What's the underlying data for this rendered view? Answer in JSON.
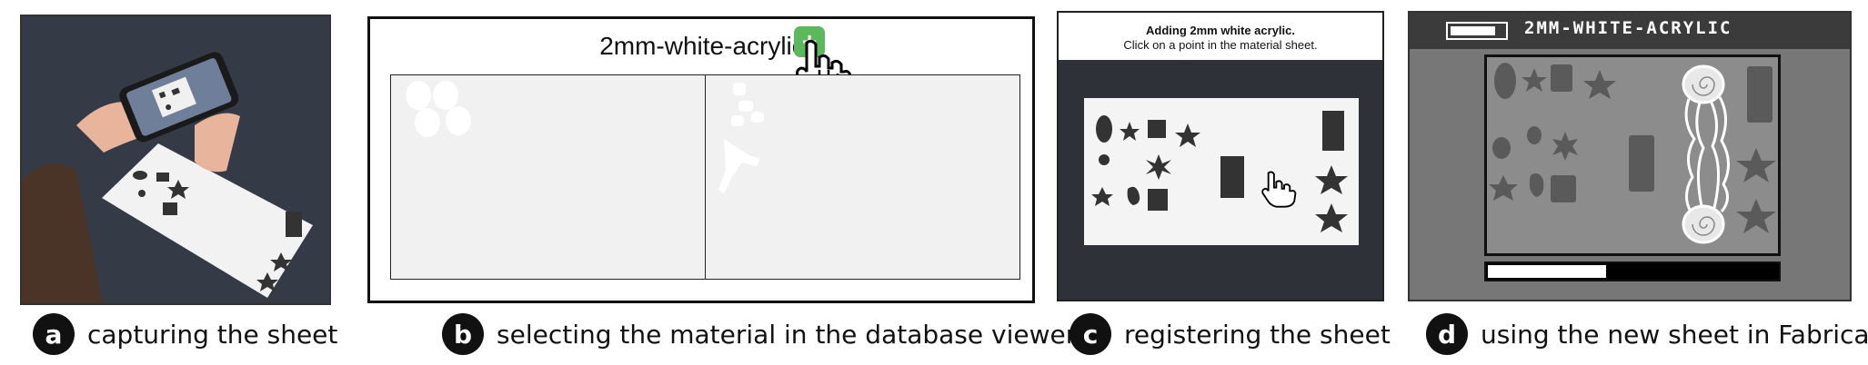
{
  "panels": {
    "a": {
      "badge": "a",
      "caption": "capturing the sheet"
    },
    "b": {
      "badge": "b",
      "caption": "selecting the material in the database viewer",
      "material_title": "2mm-white-acrylic",
      "add_icon": "plus-icon",
      "add_label": "+"
    },
    "c": {
      "badge": "c",
      "caption": "registering the sheet",
      "header_line1": "Adding 2mm white acrylic.",
      "header_line2": "Click on a point in the material sheet."
    },
    "d": {
      "badge": "d",
      "caption": "using the new sheet in Fabricaide",
      "title": "2MM-WHITE-ACRYLIC",
      "battery_level": 0.85,
      "progress": 0.41
    }
  },
  "colors": {
    "accent_green": "#5cb85c",
    "badge_bg": "#111111",
    "dark_bg": "#3b3b3b"
  }
}
